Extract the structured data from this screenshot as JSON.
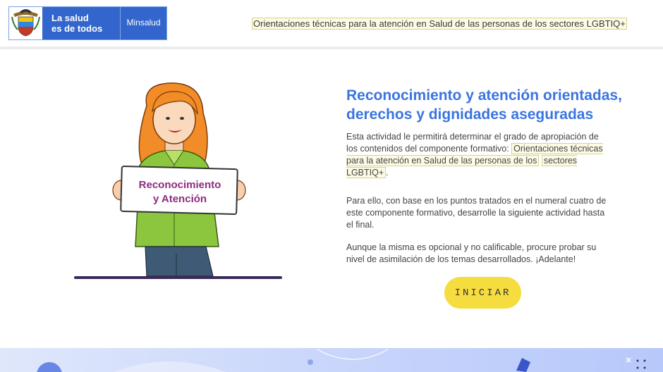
{
  "header": {
    "slogan_line1": "La salud",
    "slogan_line2": "es de todos",
    "brand": "Minsalud",
    "course_title": "Orientaciones técnicas para la atención en Salud de las personas de los sectores LGBTIQ+"
  },
  "illustration": {
    "sign_line1": "Reconocimiento",
    "sign_line2": "y Atención"
  },
  "main": {
    "title_line1": "Reconocimiento y atención orientadas,",
    "title_line2": "derechos y dignidades aseguradas",
    "p1_text": "Esta actividad le permitirá determinar el grado de apropiación de los contenidos del componente formativo: ",
    "p1_link_a": "Orientaciones técnicas para la atención en Salud de las personas de los",
    "p1_link_b": "sectores LGBTIQ+",
    "p1_end": ".",
    "p2": "Para ello, con base en los puntos tratados en el numeral cuatro de este componente formativo, desarrolle la siguiente actividad hasta el final.",
    "p3": "Aunque la misma es opcional y no calificable, procure probar su nivel de asimilación de los temas desarrollados. ¡Adelante!",
    "start_button": "INICIAR"
  },
  "colors": {
    "brand_blue": "#3366cc",
    "title_blue": "#3b74e0",
    "button_yellow": "#f6dd3f",
    "sign_purple": "#8e2a7f",
    "shirt_green": "#8cc63f"
  },
  "icons": [
    "colombia-coat-of-arms-icon"
  ]
}
